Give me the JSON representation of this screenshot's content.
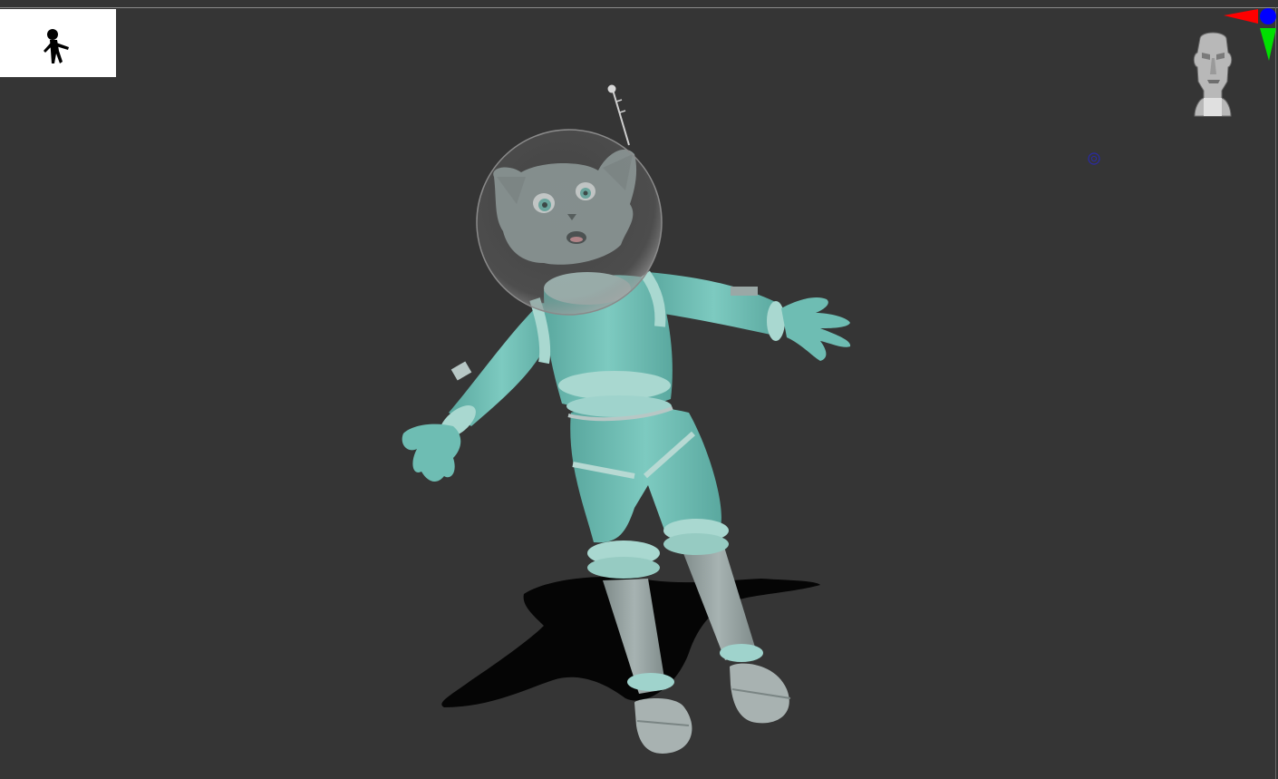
{
  "viewport": {
    "background_color": "#353535",
    "subject": "astronaut-cat-sculpt"
  },
  "thumbnail": {
    "background_color": "#ffffff",
    "silhouette_color": "#000000"
  },
  "gizmo": {
    "x_axis_color": "#ff0000",
    "y_axis_color": "#00e000",
    "z_axis_color": "#0000ff",
    "head_icon": "navigation-head-icon"
  },
  "model": {
    "suit_color": "#74c3b9",
    "trim_color": "#a9d8d0",
    "body_color": "#8a9a99",
    "helmet_color": "#9a9a9a"
  }
}
